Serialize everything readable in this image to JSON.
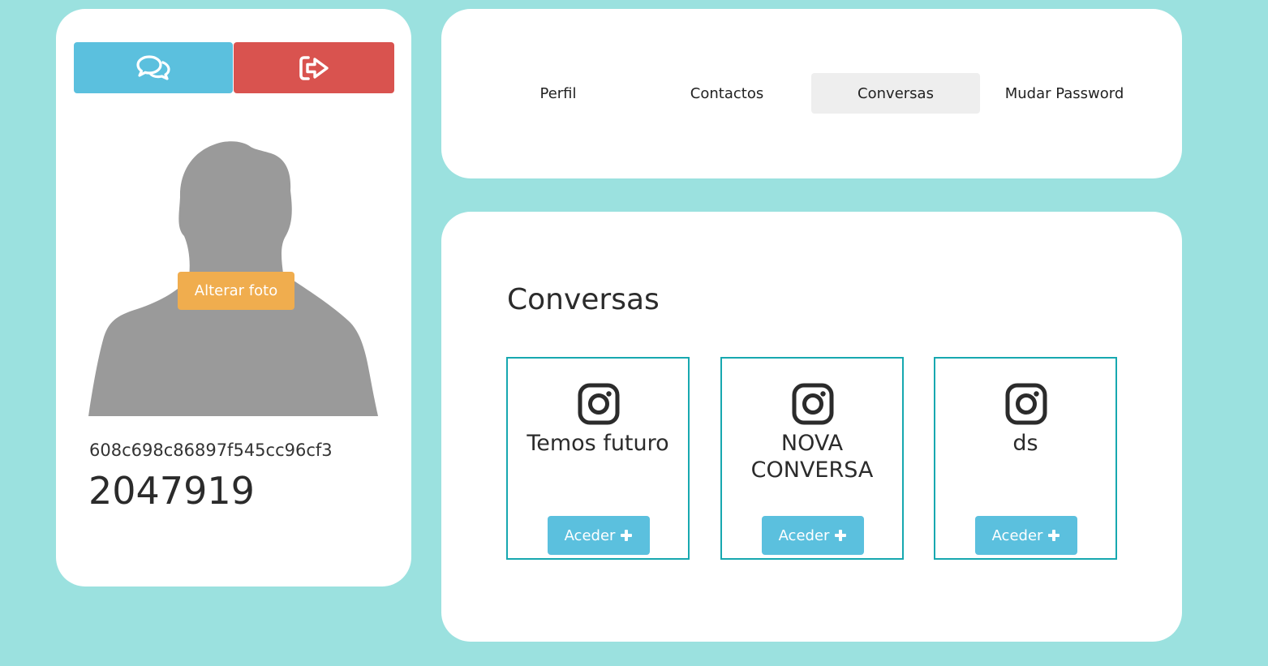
{
  "profile": {
    "chat_icon": "comments-icon",
    "logout_icon": "sign-out-icon",
    "avatar_icon": "user-silhouette",
    "change_photo_label": "Alterar foto",
    "user_id": "608c698c86897f545cc96cf3",
    "user_number": "2047919"
  },
  "nav": {
    "tabs": [
      {
        "label": "Perfil",
        "active": false
      },
      {
        "label": "Contactos",
        "active": false
      },
      {
        "label": "Conversas",
        "active": true
      },
      {
        "label": "Mudar Password",
        "active": false
      }
    ]
  },
  "conversations": {
    "title": "Conversas",
    "items": [
      {
        "name": "Temos futuro",
        "icon": "instagram-icon",
        "button_label": "Aceder"
      },
      {
        "name": "NOVA CONVERSA",
        "icon": "instagram-icon",
        "button_label": "Aceder"
      },
      {
        "name": "ds",
        "icon": "instagram-icon",
        "button_label": "Aceder"
      }
    ]
  },
  "colors": {
    "background": "#9be1df",
    "info": "#5bc0de",
    "danger": "#d9534f",
    "warning": "#f0ad4e",
    "teal_border": "#17a8b0"
  }
}
